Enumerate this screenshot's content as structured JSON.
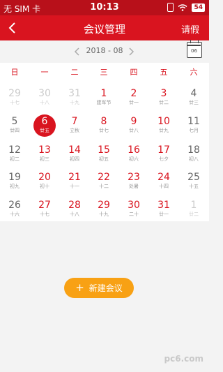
{
  "status_bar": {
    "carrier": "无 SIM 卡",
    "time": "10:13",
    "battery": "54"
  },
  "nav": {
    "title": "会议管理",
    "right_action": "请假"
  },
  "month_bar": {
    "month": "2018 - 08",
    "calendar_button_day": "06"
  },
  "weekdays": [
    "日",
    "一",
    "二",
    "三",
    "四",
    "五",
    "六"
  ],
  "days": [
    {
      "day": "29",
      "lunar": "十七",
      "in_month": false
    },
    {
      "day": "30",
      "lunar": "十八",
      "in_month": false
    },
    {
      "day": "31",
      "lunar": "十九",
      "in_month": false
    },
    {
      "day": "1",
      "lunar": "建军节",
      "in_month": true
    },
    {
      "day": "2",
      "lunar": "廿一",
      "in_month": true
    },
    {
      "day": "3",
      "lunar": "廿二",
      "in_month": true
    },
    {
      "day": "4",
      "lunar": "廿三",
      "in_month": true
    },
    {
      "day": "5",
      "lunar": "廿四",
      "in_month": true
    },
    {
      "day": "6",
      "lunar": "廿五",
      "in_month": true,
      "selected": true
    },
    {
      "day": "7",
      "lunar": "立秋",
      "in_month": true
    },
    {
      "day": "8",
      "lunar": "廿七",
      "in_month": true
    },
    {
      "day": "9",
      "lunar": "廿八",
      "in_month": true
    },
    {
      "day": "10",
      "lunar": "廿九",
      "in_month": true
    },
    {
      "day": "11",
      "lunar": "七月",
      "in_month": true
    },
    {
      "day": "12",
      "lunar": "初二",
      "in_month": true
    },
    {
      "day": "13",
      "lunar": "初三",
      "in_month": true
    },
    {
      "day": "14",
      "lunar": "初四",
      "in_month": true
    },
    {
      "day": "15",
      "lunar": "初五",
      "in_month": true
    },
    {
      "day": "16",
      "lunar": "初六",
      "in_month": true
    },
    {
      "day": "17",
      "lunar": "七夕",
      "in_month": true
    },
    {
      "day": "18",
      "lunar": "初八",
      "in_month": true
    },
    {
      "day": "19",
      "lunar": "初九",
      "in_month": true
    },
    {
      "day": "20",
      "lunar": "初十",
      "in_month": true
    },
    {
      "day": "21",
      "lunar": "十一",
      "in_month": true
    },
    {
      "day": "22",
      "lunar": "十二",
      "in_month": true
    },
    {
      "day": "23",
      "lunar": "处暑",
      "in_month": true
    },
    {
      "day": "24",
      "lunar": "十四",
      "in_month": true
    },
    {
      "day": "25",
      "lunar": "十五",
      "in_month": true
    },
    {
      "day": "26",
      "lunar": "十六",
      "in_month": true
    },
    {
      "day": "27",
      "lunar": "十七",
      "in_month": true
    },
    {
      "day": "28",
      "lunar": "十八",
      "in_month": true
    },
    {
      "day": "29",
      "lunar": "十九",
      "in_month": true
    },
    {
      "day": "30",
      "lunar": "二十",
      "in_month": true
    },
    {
      "day": "31",
      "lunar": "廿一",
      "in_month": true
    },
    {
      "day": "1",
      "lunar": "廿二",
      "in_month": false
    }
  ],
  "new_meeting_label": "新建会议",
  "watermark": "pc6.com",
  "colors": {
    "primary": "#d9141f",
    "status_bar": "#b8101a",
    "button": "#f8a114"
  }
}
